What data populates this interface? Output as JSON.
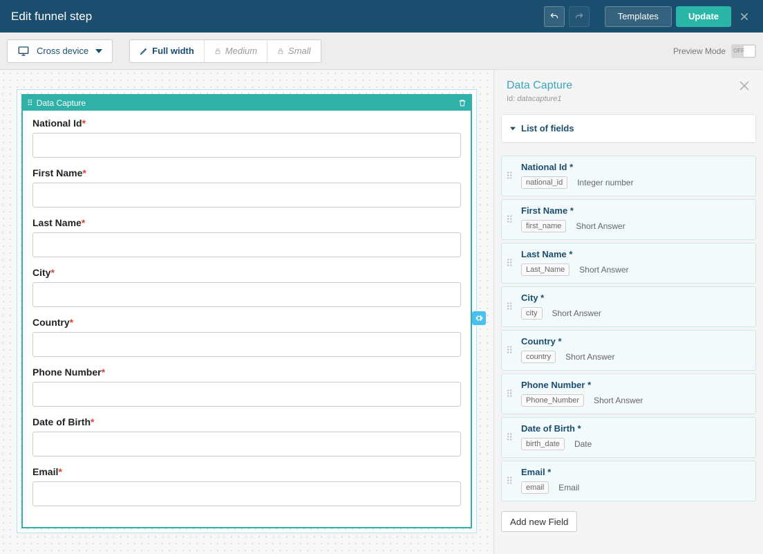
{
  "header": {
    "title": "Edit funnel step",
    "templates_label": "Templates",
    "update_label": "Update"
  },
  "toolbar": {
    "device_label": "Cross device",
    "widths": {
      "full": "Full width",
      "medium": "Medium",
      "small": "Small"
    },
    "preview_label": "Preview Mode",
    "toggle_off": "OFF"
  },
  "widget": {
    "title": "Data Capture"
  },
  "form_fields": [
    {
      "label": "National Id"
    },
    {
      "label": "First Name"
    },
    {
      "label": "Last Name"
    },
    {
      "label": "City"
    },
    {
      "label": "Country"
    },
    {
      "label": "Phone Number"
    },
    {
      "label": "Date of Birth"
    },
    {
      "label": "Email"
    }
  ],
  "panel": {
    "title": "Data Capture",
    "id_label": "Id:",
    "id_value": "datacapture1",
    "section_title": "List of fields",
    "add_field_label": "Add new Field",
    "required_mark": "*",
    "fields": [
      {
        "title": "National Id",
        "tag": "national_id",
        "type": "Integer number"
      },
      {
        "title": "First Name",
        "tag": "first_name",
        "type": "Short Answer"
      },
      {
        "title": "Last Name",
        "tag": "Last_Name",
        "type": "Short Answer"
      },
      {
        "title": "City",
        "tag": "city",
        "type": "Short Answer"
      },
      {
        "title": "Country",
        "tag": "country",
        "type": "Short Answer"
      },
      {
        "title": "Phone Number",
        "tag": "Phone_Number",
        "type": "Short Answer"
      },
      {
        "title": "Date of Birth",
        "tag": "birth_date",
        "type": "Date"
      },
      {
        "title": "Email",
        "tag": "email",
        "type": "Email"
      }
    ]
  }
}
